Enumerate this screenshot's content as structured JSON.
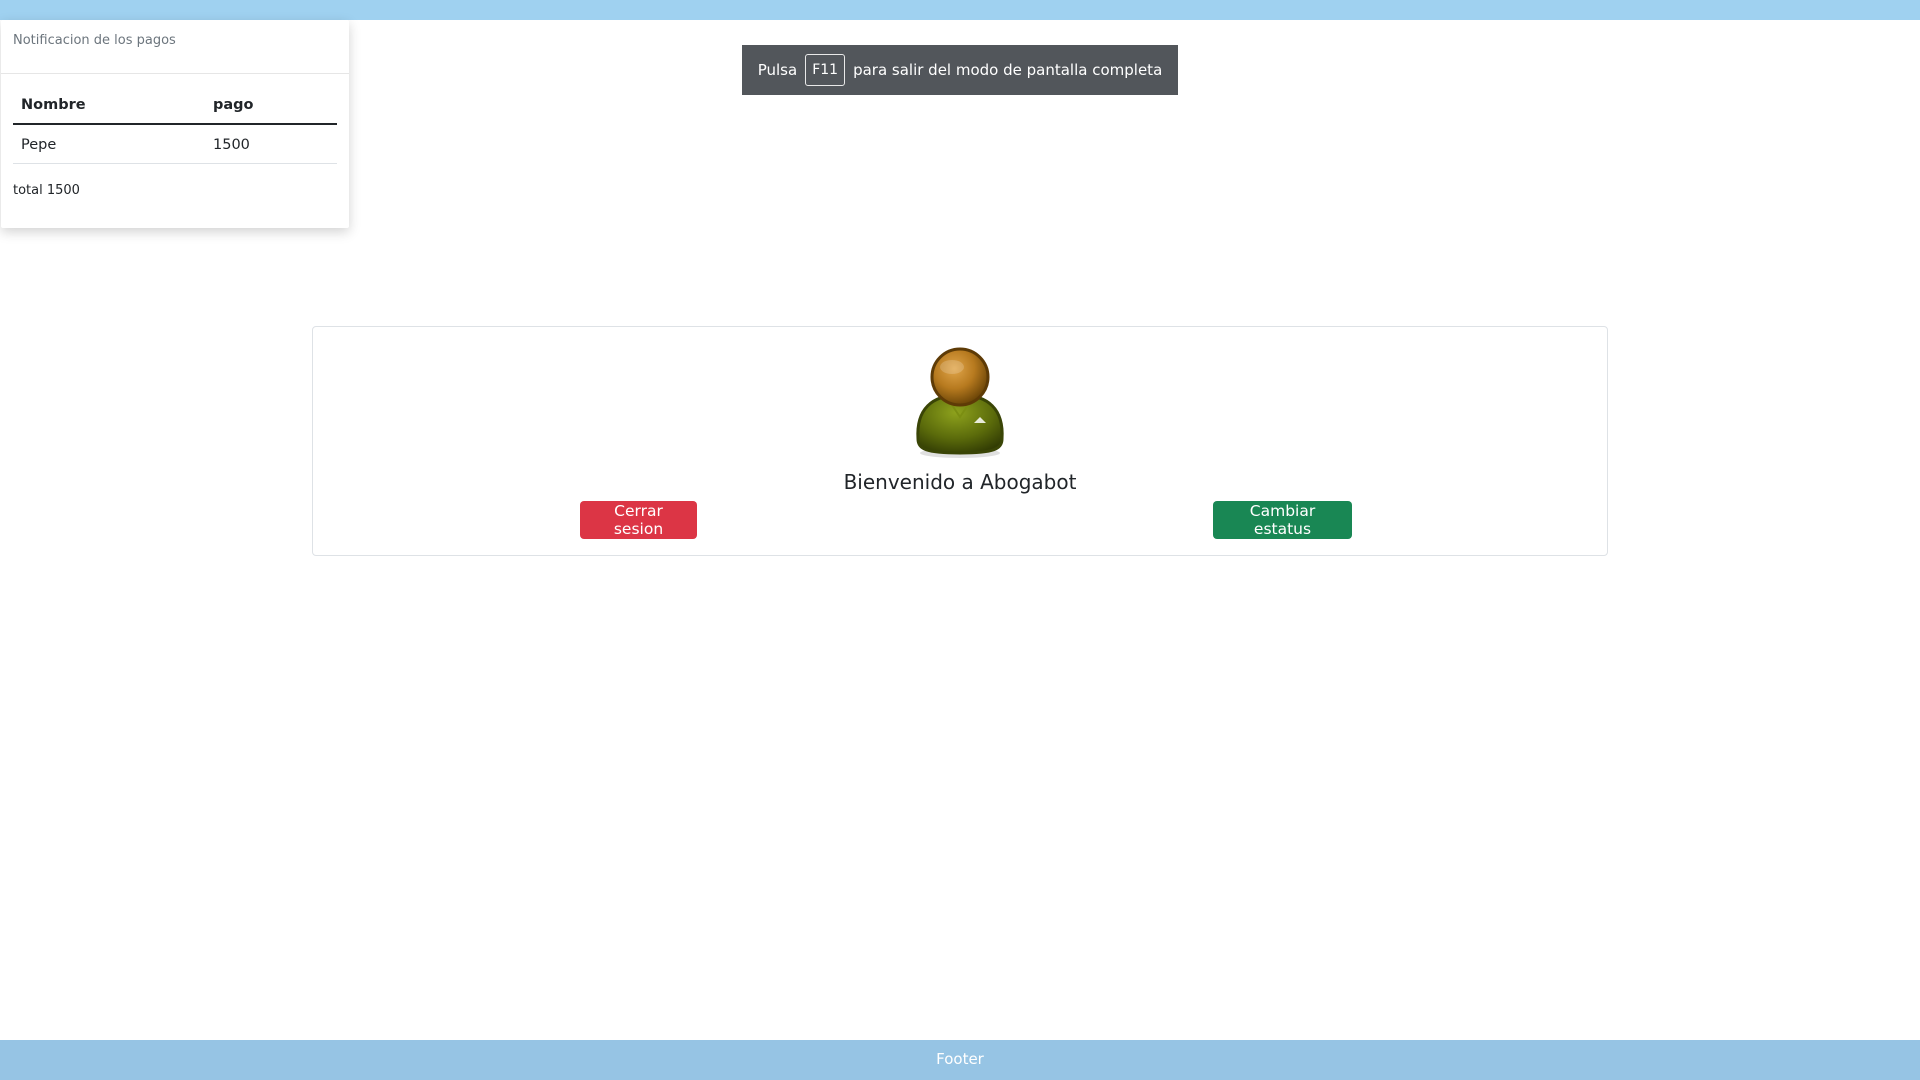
{
  "notification": {
    "header": "Notificacion de los pagos",
    "columns": [
      "Nombre",
      "pago"
    ],
    "rows": [
      {
        "nombre": "Pepe",
        "pago": "1500"
      }
    ],
    "total": "total 1500"
  },
  "fullscreen_toast": {
    "prefix": "Pulsa",
    "key": "F11",
    "suffix": "para salir del modo de pantalla completa"
  },
  "welcome": {
    "title": "Bienvenido a Abogabot",
    "logout_label": "Cerrar sesion",
    "status_label": "Cambiar estatus"
  },
  "footer": {
    "text": "Footer"
  },
  "colors": {
    "top_bar": "#9fd1f0",
    "footer": "#96c4e4",
    "danger": "#dc3545",
    "success": "#198754",
    "toast": "#52565b"
  },
  "icons": {
    "avatar": "user-avatar-icon"
  }
}
